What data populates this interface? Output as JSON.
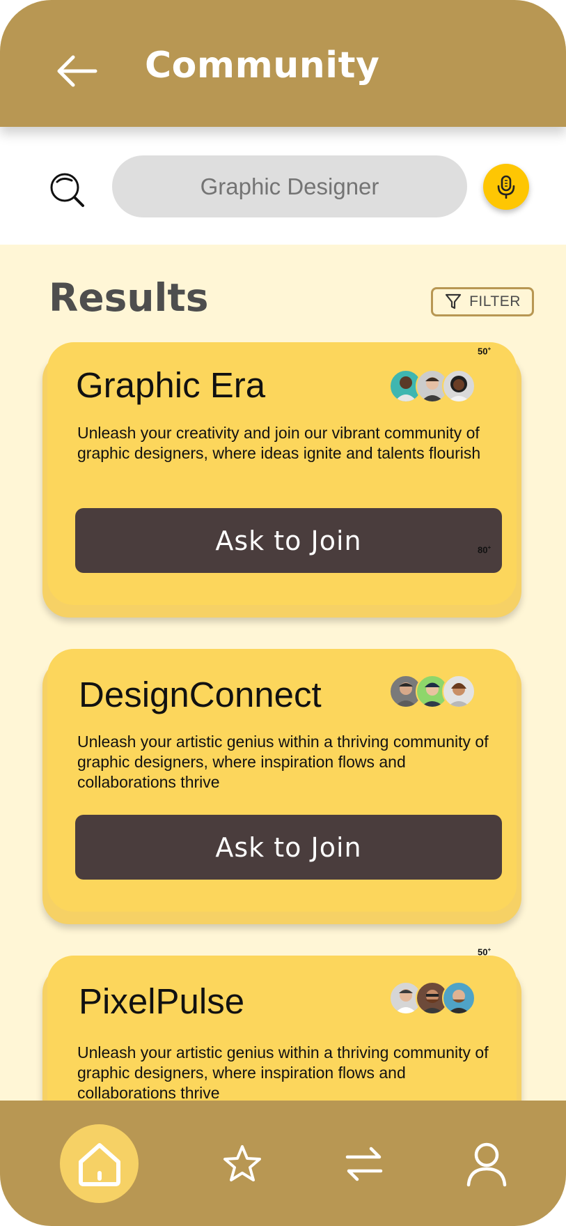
{
  "header": {
    "title": "Community",
    "back_icon": "arrow-left-icon"
  },
  "search": {
    "value": "Graphic Designer",
    "placeholder": "Graphic Designer",
    "search_icon": "search-icon",
    "mic_icon": "microphone-icon"
  },
  "results": {
    "title": "Results",
    "filter_label": "FILTER",
    "filter_icon": "filter-icon"
  },
  "cards": [
    {
      "title": "Graphic Era",
      "description": "Unleash your creativity and join our vibrant community of graphic designers, where ideas ignite and talents flourish",
      "button_label": "Ask to Join",
      "member_count": "50",
      "member_count_suffix": "+",
      "member_count_2": "80",
      "member_count_2_suffix": "+"
    },
    {
      "title": "DesignConnect",
      "description": "Unleash your artistic genius within a thriving community of graphic designers, where inspiration flows and collaborations thrive",
      "button_label": "Ask to Join"
    },
    {
      "title": "PixelPulse",
      "description": "Unleash your artistic genius within a thriving community of graphic designers, where inspiration flows and collaborations thrive",
      "member_count": "50",
      "member_count_suffix": "+"
    }
  ],
  "nav": {
    "items": [
      "home-icon",
      "star-icon",
      "swap-arrows-icon",
      "user-icon"
    ],
    "active": "home-icon"
  },
  "colors": {
    "header_bg": "#B89753",
    "page_bg": "#FFF6D6",
    "card_bg": "#FCD65C",
    "button_bg": "#4A3D3D",
    "mic_bg": "#FEC603",
    "search_field_bg": "#DEDEDE"
  }
}
